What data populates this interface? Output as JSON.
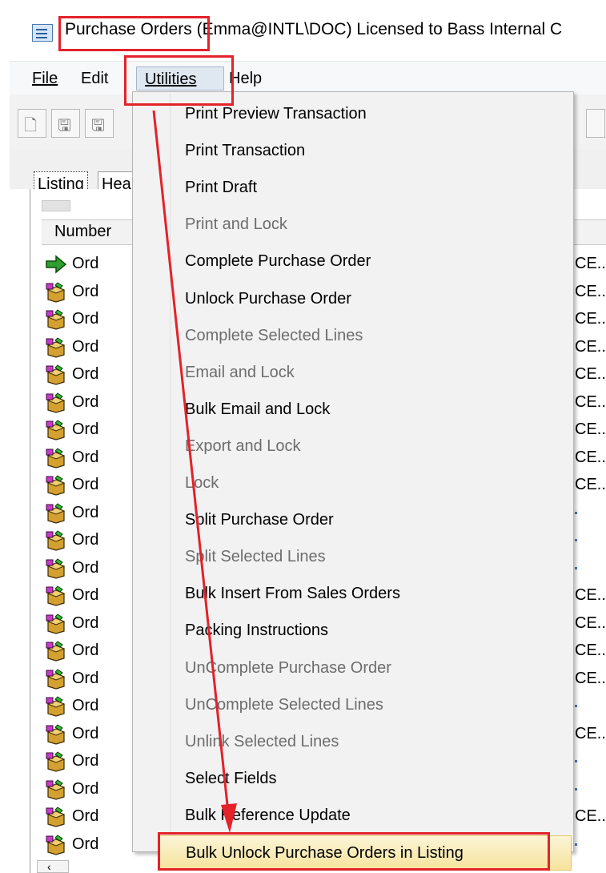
{
  "window": {
    "title_app": "Purchase Orders",
    "title_rest": "(Emma@INTL\\DOC) Licensed to Bass Internal C"
  },
  "menubar": {
    "items": [
      {
        "label": "File",
        "accel": "F"
      },
      {
        "label": "Edit",
        "accel": "E"
      },
      {
        "label": "Utilities",
        "accel": "U"
      },
      {
        "label": "Help",
        "accel": "H"
      }
    ]
  },
  "tabs": {
    "listing": "Listing",
    "header": "Hea"
  },
  "listing": {
    "column_header": "Number",
    "rows": [
      {
        "text": "Ord",
        "icon": "green-arrow-icon"
      },
      {
        "text": "Ord",
        "icon": "order-box-icon"
      },
      {
        "text": "Ord",
        "icon": "order-box-icon"
      },
      {
        "text": "Ord",
        "icon": "order-box-icon"
      },
      {
        "text": "Ord",
        "icon": "order-box-icon"
      },
      {
        "text": "Ord",
        "icon": "order-box-icon"
      },
      {
        "text": "Ord",
        "icon": "order-box-icon"
      },
      {
        "text": "Ord",
        "icon": "order-box-icon"
      },
      {
        "text": "Ord",
        "icon": "order-box-icon"
      },
      {
        "text": "Ord",
        "icon": "order-box-icon"
      },
      {
        "text": "Ord",
        "icon": "order-box-icon"
      },
      {
        "text": "Ord",
        "icon": "order-box-icon"
      },
      {
        "text": "Ord",
        "icon": "order-box-icon"
      },
      {
        "text": "Ord",
        "icon": "order-box-icon"
      },
      {
        "text": "Ord",
        "icon": "order-box-icon"
      },
      {
        "text": "Ord",
        "icon": "order-box-icon"
      },
      {
        "text": "Ord",
        "icon": "order-box-icon"
      },
      {
        "text": "Ord",
        "icon": "order-box-icon"
      },
      {
        "text": "Ord",
        "icon": "order-box-icon"
      },
      {
        "text": "Ord",
        "icon": "order-box-icon"
      },
      {
        "text": "Ord",
        "icon": "order-box-icon"
      },
      {
        "text": "Ord",
        "icon": "order-box-icon"
      }
    ],
    "right_column_text": "CE..",
    "right_column_rows": [
      "CE..",
      "CE..",
      "CE..",
      "CE..",
      "CE..",
      "CE..",
      "CE..",
      "CE..",
      "CE..",
      "",
      "",
      "",
      "CE..",
      "CE..",
      "CE..",
      "CE..",
      "",
      "CE..",
      "",
      "",
      "CE..",
      ""
    ]
  },
  "utilities_menu": {
    "items": [
      {
        "label": "Print Preview Transaction",
        "enabled": true
      },
      {
        "label": "Print Transaction",
        "enabled": true
      },
      {
        "label": "Print Draft",
        "enabled": true
      },
      {
        "label": "Print and Lock",
        "enabled": false
      },
      {
        "label": "Complete Purchase Order",
        "enabled": true
      },
      {
        "label": "Unlock Purchase Order",
        "enabled": true
      },
      {
        "label": "Complete Selected Lines",
        "enabled": false
      },
      {
        "label": "Email and Lock",
        "enabled": false
      },
      {
        "label": "Bulk Email and Lock",
        "enabled": true
      },
      {
        "label": "Export and Lock",
        "enabled": false
      },
      {
        "label": "Lock",
        "enabled": false
      },
      {
        "label": "Split Purchase Order",
        "enabled": true
      },
      {
        "label": "Split Selected Lines",
        "enabled": false
      },
      {
        "label": "Bulk Insert From Sales Orders",
        "enabled": true
      },
      {
        "label": "Packing Instructions",
        "enabled": true
      },
      {
        "label": "UnComplete Purchase Order",
        "enabled": false
      },
      {
        "label": "UnComplete Selected Lines",
        "enabled": false
      },
      {
        "label": "Unlink Selected Lines",
        "enabled": false
      },
      {
        "label": "Select Fields",
        "enabled": true
      },
      {
        "label": "Bulk Reference Update",
        "enabled": true
      },
      {
        "label": "Bulk Unlock Purchase Orders in Listing",
        "enabled": true,
        "highlighted": true
      }
    ]
  },
  "colors": {
    "annotation_red": "#e3222a",
    "highlight_bg": "#f6e39d",
    "disabled_text": "#6d6d6d"
  }
}
